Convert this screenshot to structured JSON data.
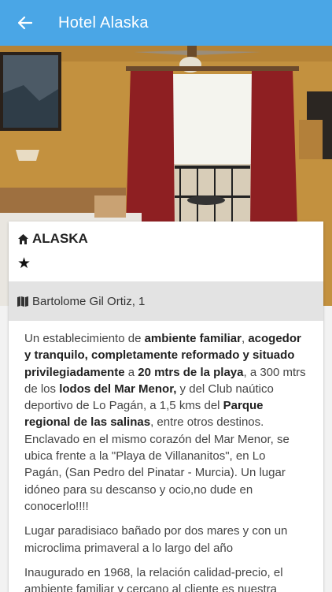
{
  "appbar": {
    "title": "Hotel Alaska"
  },
  "hotel": {
    "name": "ALASKA",
    "stars": "★",
    "address": "Bartolome Gil Ortiz, 1"
  },
  "description": {
    "p1": [
      "Un establecimiento de ",
      "ambiente familiar",
      ", ",
      "acogedor y tranquilo, completamente reformado y situado privilegiadamente",
      " a ",
      "20 mtrs de la playa",
      ", a 300 mtrs de los ",
      "lodos del Mar Menor,",
      " y del Club naútico deportivo de Lo Pagán, a 1,5 kms del ",
      "Parque regional de las salinas",
      ", entre otros destinos. Enclavado en el mismo corazón del Mar Menor, se ubica frente a la \"Playa de Villananitos\", en Lo Pagán, (San Pedro del Pinatar - Murcia). Un lugar idóneo para su descanso y ocio,no dude en conocerlo!!!!"
    ],
    "p2": "Lugar paradisiaco bañado por dos mares y con un microclima primaveral a lo largo del año",
    "p3": "Inaugurado en 1968, la relación calidad-precio, el ambiente familiar y cercano al cliente es nuestra"
  },
  "colors": {
    "appbar": "#4aa6e6",
    "address_bg": "#e3e3e3"
  },
  "icons": {
    "back": "arrow-left-icon",
    "name": "home-icon",
    "address": "map-icon"
  }
}
